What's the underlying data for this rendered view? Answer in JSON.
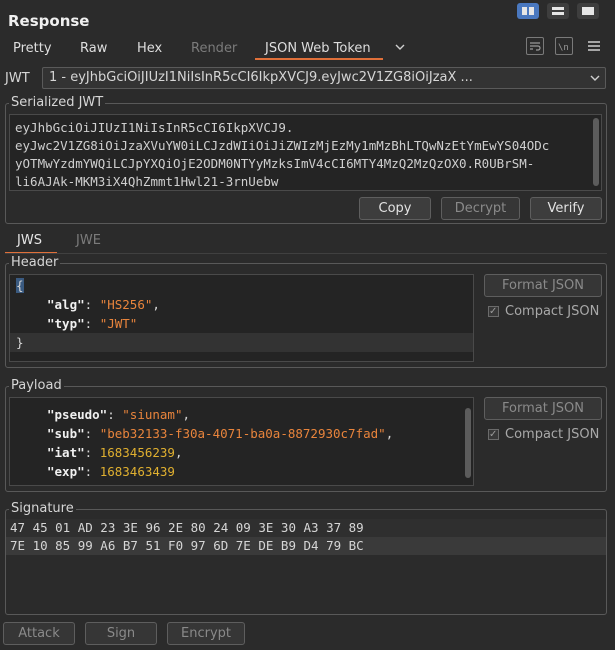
{
  "panel": {
    "title": "Response"
  },
  "view_tabs": [
    {
      "label": "Pretty",
      "enabled": true
    },
    {
      "label": "Raw",
      "enabled": true
    },
    {
      "label": "Hex",
      "enabled": true
    },
    {
      "label": "Render",
      "enabled": false
    },
    {
      "label": "JSON Web Token",
      "enabled": true,
      "selected": true
    }
  ],
  "jwt_selector": {
    "label": "JWT",
    "value": "1 - eyJhbGciOiJIUzI1NiIsInR5cCI6IkpXVCJ9.eyJwc2V1ZG8iOiJzaX ..."
  },
  "serialized": {
    "legend": "Serialized JWT",
    "lines": [
      "eyJhbGciOiJIUzI1NiIsInR5cCI6IkpXVCJ9.",
      "eyJwc2V1ZG8iOiJzaXVuYW0iLCJzdWIiOiJiZWIzMjEzMy1mMzBhLTQwNzEtYmEwYS04ODc",
      "yOTMwYzdmYWQiLCJpYXQiOjE2ODM0NTYyMzksImV4cCI6MTY4MzQ2MzQzOX0.R0UBrSM-",
      "li6AJAk-MKM3iX4QhZmmt1Hwl21-3rnUebw"
    ],
    "buttons": {
      "copy": "Copy",
      "decrypt": "Decrypt",
      "verify": "Verify"
    }
  },
  "sig_tabs": {
    "jws": "JWS",
    "jwe": "JWE"
  },
  "header_section": {
    "legend": "Header",
    "open_brace": "{",
    "close_brace": "}",
    "alg_key": "\"alg\"",
    "alg_value": "\"HS256\"",
    "typ_key": "\"typ\"",
    "typ_value": "\"JWT\"",
    "format_button": "Format JSON",
    "compact_label": "Compact JSON"
  },
  "payload_section": {
    "legend": "Payload",
    "pseudo_key": "\"pseudo\"",
    "pseudo_value": "\"siunam\"",
    "sub_key": "\"sub\"",
    "sub_value": "\"beb32133-f30a-4071-ba0a-8872930c7fad\"",
    "iat_key": "\"iat\"",
    "iat_value": "1683456239",
    "exp_key": "\"exp\"",
    "exp_value": "1683463439",
    "format_button": "Format JSON",
    "compact_label": "Compact JSON"
  },
  "signature": {
    "legend": "Signature",
    "rows": [
      "47 45 01 AD 23 3E 96 2E 80 24 09 3E 30 A3 37 89",
      "7E 10 85 99 A6 B7 51 F0 97 6D 7E DE B9 D4 79 BC"
    ]
  },
  "bottom_buttons": {
    "attack": "Attack",
    "sign": "Sign",
    "encrypt": "Encrypt"
  },
  "colors": {
    "accent": "#e0703a",
    "string": "#e8843c",
    "number": "#e0b030",
    "layout_active": "#4a78bf"
  }
}
